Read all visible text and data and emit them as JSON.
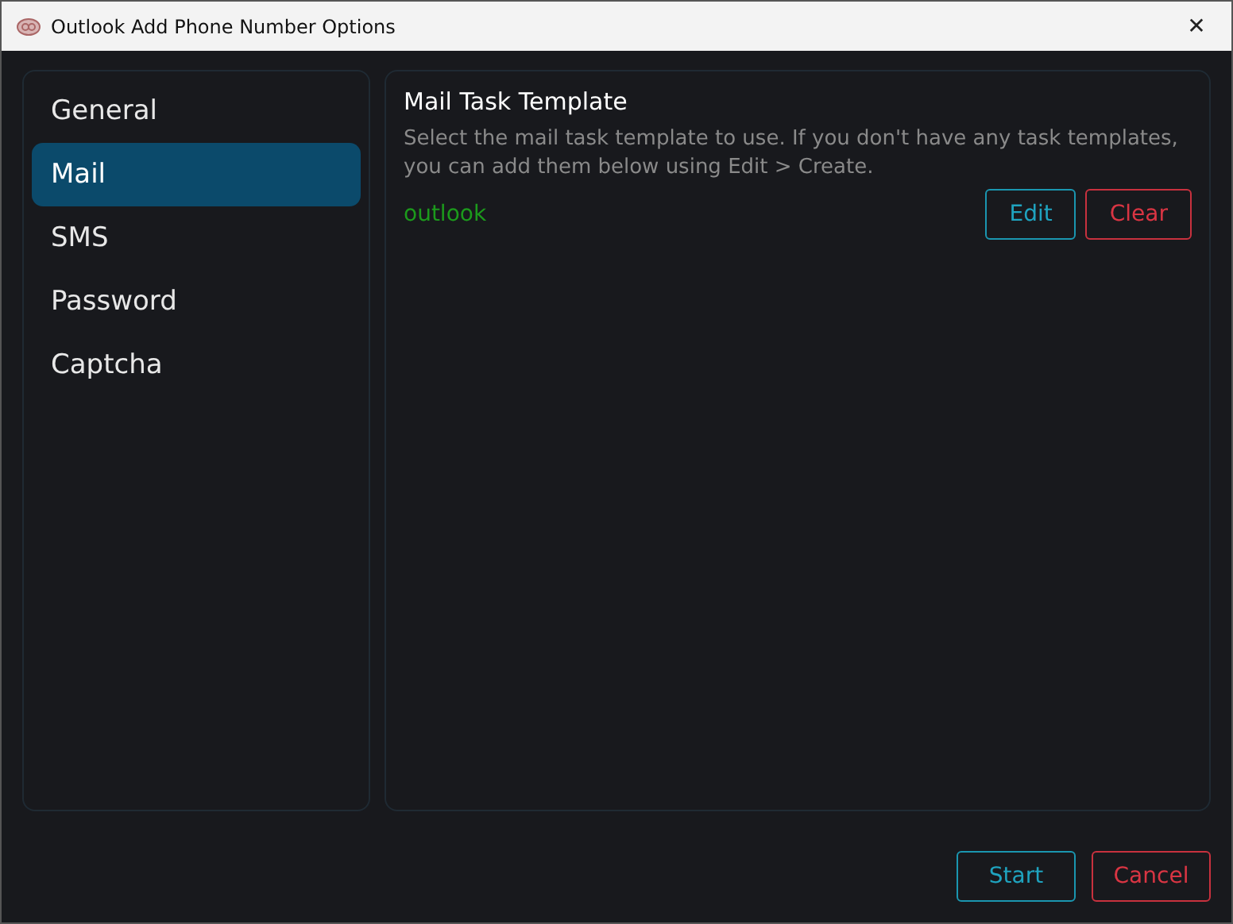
{
  "window": {
    "title": "Outlook Add Phone Number Options",
    "close": "✕"
  },
  "sidebar": {
    "items": [
      {
        "label": "General",
        "selected": false
      },
      {
        "label": "Mail",
        "selected": true
      },
      {
        "label": "SMS",
        "selected": false
      },
      {
        "label": "Password",
        "selected": false
      },
      {
        "label": "Captcha",
        "selected": false
      }
    ]
  },
  "section": {
    "title": "Mail Task Template",
    "description": "Select the mail task template to use. If you don't have any task templates, you can add them below using Edit > Create.",
    "value": "outlook",
    "buttons": [
      {
        "label": "Edit",
        "kind": "primary"
      },
      {
        "label": "Clear",
        "kind": "danger"
      }
    ]
  },
  "footer": {
    "buttons": [
      {
        "label": "Start",
        "kind": "primary"
      },
      {
        "label": "Cancel",
        "kind": "danger"
      }
    ]
  }
}
